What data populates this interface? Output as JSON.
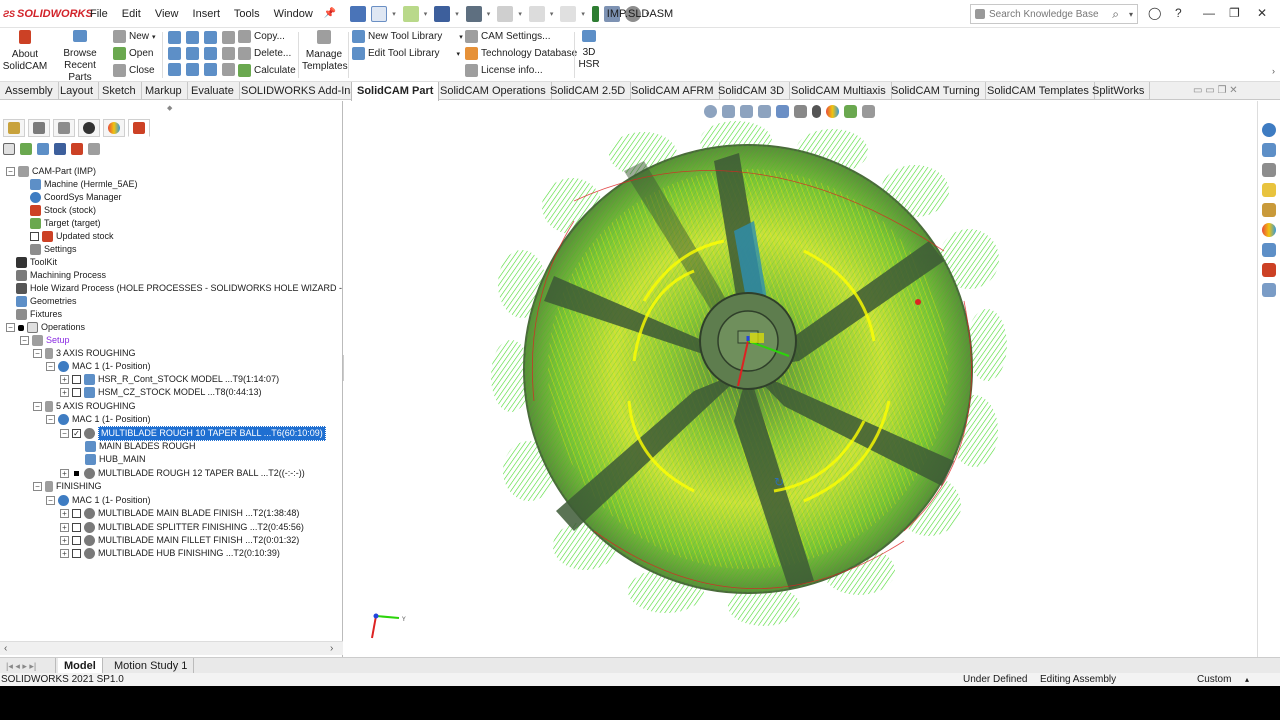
{
  "app": {
    "logo": "SOLIDWORKS",
    "document_title": "IMP.SLDASM"
  },
  "menu": [
    "File",
    "Edit",
    "View",
    "Insert",
    "Tools",
    "Window"
  ],
  "search": {
    "placeholder": "Search Knowledge Base"
  },
  "ribbon": {
    "about": "About SolidCAM",
    "browse": "Browse Recent Parts",
    "new": "New",
    "open": "Open",
    "close": "Close",
    "copy": "Copy...",
    "delete": "Delete...",
    "calculate": "Calculate",
    "manage_templates": "Manage Templates",
    "new_tool_library": "New Tool Library",
    "edit_tool_library": "Edit Tool Library",
    "cam_settings": "CAM Settings...",
    "technology_database": "Technology Database",
    "license_info": "License info...",
    "hsr": "3D HSR"
  },
  "tabs": [
    "Assembly",
    "Layout",
    "Sketch",
    "Markup",
    "Evaluate",
    "SOLIDWORKS Add-Ins",
    "SolidCAM Part",
    "SolidCAM Operations",
    "SolidCAM 2.5D",
    "SolidCAM AFRM",
    "SolidCAM 3D",
    "SolidCAM Multiaxis",
    "SolidCAM Turning",
    "SolidCAM Templates",
    "SplitWorks"
  ],
  "active_tab": "SolidCAM Part",
  "tree": [
    {
      "label": "CAM-Part (IMP)"
    },
    {
      "label": "Machine (Hermle_5AE)"
    },
    {
      "label": "CoordSys Manager"
    },
    {
      "label": "Stock (stock)"
    },
    {
      "label": "Target (target)"
    },
    {
      "label": "Updated stock"
    },
    {
      "label": "Settings"
    },
    {
      "label": "ToolKit"
    },
    {
      "label": "Machining Process"
    },
    {
      "label": "Hole Wizard Process (HOLE PROCESSES - SOLIDWORKS HOLE WIZARD - METRIC"
    },
    {
      "label": "Geometries"
    },
    {
      "label": "Fixtures"
    },
    {
      "label": "Operations"
    },
    {
      "label": "Setup"
    },
    {
      "label": "3 AXIS ROUGHING"
    },
    {
      "label": "MAC 1 (1- Position)"
    },
    {
      "label": "HSR_R_Cont_STOCK MODEL ...T9(1:14:07)"
    },
    {
      "label": "HSM_CZ_STOCK MODEL ...T8(0:44:13)"
    },
    {
      "label": "5 AXIS ROUGHING"
    },
    {
      "label": "MAC 1 (1- Position)"
    },
    {
      "label": "MULTIBLADE ROUGH 10 TAPER BALL ...T6(60:10:09)"
    },
    {
      "label": "MAIN BLADES ROUGH"
    },
    {
      "label": "HUB_MAIN"
    },
    {
      "label": "MULTIBLADE ROUGH 12 TAPER BALL ...T2((-:-:-))"
    },
    {
      "label": "FINISHING"
    },
    {
      "label": "MAC 1 (1- Position)"
    },
    {
      "label": "MULTIBLADE MAIN BLADE FINISH ...T2(1:38:48)"
    },
    {
      "label": "MULTIBLADE SPLITTER FINISHING ...T2(0:45:56)"
    },
    {
      "label": "MULTIBLADE MAIN FILLET FINISH ...T2(0:01:32)"
    },
    {
      "label": "MULTIBLADE HUB FINISHING ...T2(0:10:39)"
    }
  ],
  "bottom_tabs": [
    "Model",
    "Motion Study 1"
  ],
  "status": {
    "version": "SOLIDWORKS 2021 SP1.0",
    "defined": "Under Defined",
    "mode": "Editing Assembly",
    "units": "Custom"
  },
  "colors": {
    "accent": "#1f6fd1",
    "toolpath_green": "#38e000",
    "stock_yellow": "#e6e600",
    "logo_red": "#d2232a"
  }
}
